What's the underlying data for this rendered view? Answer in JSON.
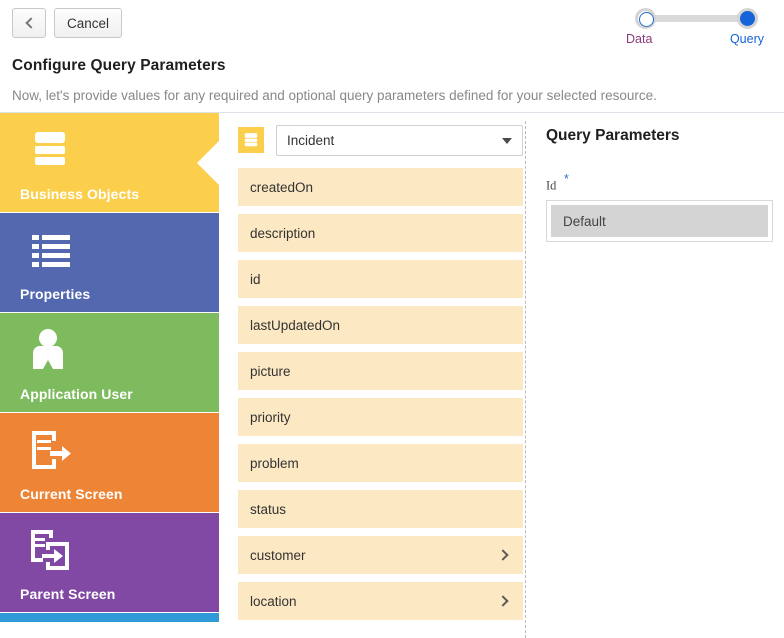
{
  "header": {
    "back_button_icon": "chevron-left-icon",
    "cancel_label": "Cancel",
    "title": "Configure Query Parameters",
    "subtitle": "Now, let's provide values for any required and optional query parameters defined for your selected resource."
  },
  "stepper": {
    "steps": [
      {
        "label": "Data",
        "state": "completed",
        "color": "#8b3a7b"
      },
      {
        "label": "Query",
        "state": "current",
        "color": "#1565d8"
      }
    ],
    "track_color": "#d9d9d9",
    "active_color": "#1565d8"
  },
  "sidebar": {
    "tiles": [
      {
        "label": "Business Objects",
        "color": "#fbcf4b",
        "icon": "database-icon",
        "selected": true
      },
      {
        "label": "Properties",
        "color": "#5468b0",
        "icon": "list-icon",
        "selected": false
      },
      {
        "label": "Application User",
        "color": "#7dbb5e",
        "icon": "user-icon",
        "selected": false
      },
      {
        "label": "Current Screen",
        "color": "#ed8436",
        "icon": "screen-out-icon",
        "selected": false
      },
      {
        "label": "Parent Screen",
        "color": "#8149a4",
        "icon": "screens-out-icon",
        "selected": false
      },
      {
        "label": "",
        "color": "#2f9ad8",
        "icon": "",
        "selected": false
      }
    ]
  },
  "middle": {
    "source_icon": "database-icon",
    "source_selected": "Incident",
    "source_caret": "chevron-down-icon",
    "fields": [
      {
        "label": "createdOn",
        "expandable": false
      },
      {
        "label": "description",
        "expandable": false
      },
      {
        "label": "id",
        "expandable": false
      },
      {
        "label": "lastUpdatedOn",
        "expandable": false
      },
      {
        "label": "picture",
        "expandable": false
      },
      {
        "label": "priority",
        "expandable": false
      },
      {
        "label": "problem",
        "expandable": false
      },
      {
        "label": "status",
        "expandable": false
      },
      {
        "label": "customer",
        "expandable": true
      },
      {
        "label": "location",
        "expandable": true
      }
    ]
  },
  "query_parameters": {
    "title": "Query Parameters",
    "parameters": [
      {
        "label": "Id",
        "required_marker": "*",
        "value": "Default"
      }
    ]
  },
  "colors": {
    "field_background": "#fce8c3",
    "input_background": "#d4d4d4",
    "required_asterisk": "#2f6fd0"
  }
}
